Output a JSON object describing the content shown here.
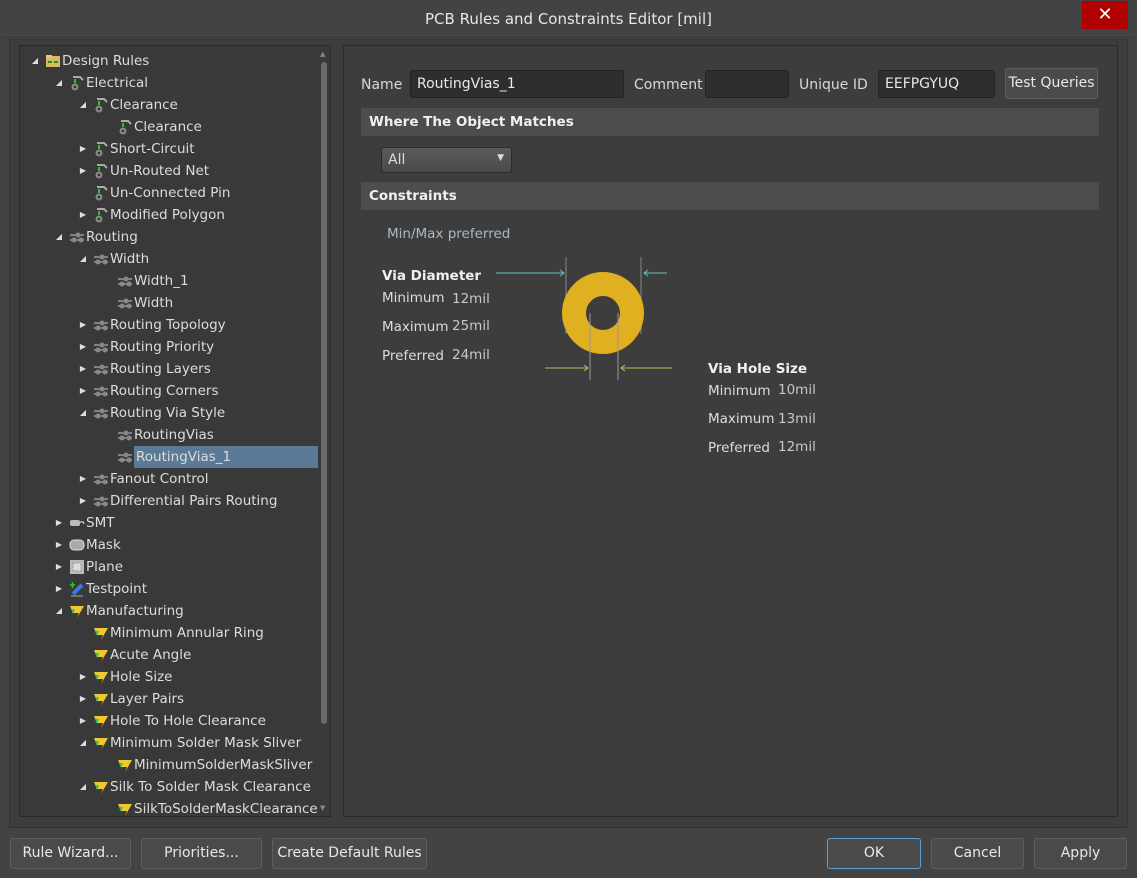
{
  "window": {
    "title": "PCB Rules and Constraints Editor [mil]",
    "close_icon": "close-icon"
  },
  "tree": [
    {
      "level": 0,
      "exp": "open",
      "icon": "folder",
      "label": "Design Rules"
    },
    {
      "level": 1,
      "exp": "open",
      "icon": "electrical",
      "label": "Electrical"
    },
    {
      "level": 2,
      "exp": "open",
      "icon": "electrical",
      "label": "Clearance"
    },
    {
      "level": 3,
      "exp": "none",
      "icon": "electrical",
      "label": "Clearance"
    },
    {
      "level": 2,
      "exp": "closed",
      "icon": "electrical",
      "label": "Short-Circuit"
    },
    {
      "level": 2,
      "exp": "closed",
      "icon": "electrical",
      "label": "Un-Routed Net"
    },
    {
      "level": 2,
      "exp": "none",
      "icon": "electrical",
      "label": "Un-Connected Pin"
    },
    {
      "level": 2,
      "exp": "closed",
      "icon": "electrical",
      "label": "Modified Polygon"
    },
    {
      "level": 1,
      "exp": "open",
      "icon": "routing",
      "label": "Routing"
    },
    {
      "level": 2,
      "exp": "open",
      "icon": "routing",
      "label": "Width"
    },
    {
      "level": 3,
      "exp": "none",
      "icon": "routing",
      "label": "Width_1"
    },
    {
      "level": 3,
      "exp": "none",
      "icon": "routing",
      "label": "Width"
    },
    {
      "level": 2,
      "exp": "closed",
      "icon": "routing",
      "label": "Routing Topology"
    },
    {
      "level": 2,
      "exp": "closed",
      "icon": "routing",
      "label": "Routing Priority"
    },
    {
      "level": 2,
      "exp": "closed",
      "icon": "routing",
      "label": "Routing Layers"
    },
    {
      "level": 2,
      "exp": "closed",
      "icon": "routing",
      "label": "Routing Corners"
    },
    {
      "level": 2,
      "exp": "open",
      "icon": "routing",
      "label": "Routing Via Style"
    },
    {
      "level": 3,
      "exp": "none",
      "icon": "routing",
      "label": "RoutingVias"
    },
    {
      "level": 3,
      "exp": "none",
      "icon": "routing",
      "label": "RoutingVias_1",
      "selected": true
    },
    {
      "level": 2,
      "exp": "closed",
      "icon": "routing",
      "label": "Fanout Control"
    },
    {
      "level": 2,
      "exp": "closed",
      "icon": "routing",
      "label": "Differential Pairs Routing"
    },
    {
      "level": 1,
      "exp": "closed",
      "icon": "smt",
      "label": "SMT"
    },
    {
      "level": 1,
      "exp": "closed",
      "icon": "mask",
      "label": "Mask"
    },
    {
      "level": 1,
      "exp": "closed",
      "icon": "plane",
      "label": "Plane"
    },
    {
      "level": 1,
      "exp": "closed",
      "icon": "testpoint",
      "label": "Testpoint"
    },
    {
      "level": 1,
      "exp": "open",
      "icon": "manufacturing",
      "label": "Manufacturing"
    },
    {
      "level": 2,
      "exp": "none",
      "icon": "manufacturing",
      "label": "Minimum Annular Ring"
    },
    {
      "level": 2,
      "exp": "none",
      "icon": "manufacturing",
      "label": "Acute Angle"
    },
    {
      "level": 2,
      "exp": "closed",
      "icon": "manufacturing",
      "label": "Hole Size"
    },
    {
      "level": 2,
      "exp": "closed",
      "icon": "manufacturing",
      "label": "Layer Pairs"
    },
    {
      "level": 2,
      "exp": "closed",
      "icon": "manufacturing",
      "label": "Hole To Hole Clearance"
    },
    {
      "level": 2,
      "exp": "open",
      "icon": "manufacturing",
      "label": "Minimum Solder Mask Sliver"
    },
    {
      "level": 3,
      "exp": "none",
      "icon": "manufacturing",
      "label": "MinimumSolderMaskSliver"
    },
    {
      "level": 2,
      "exp": "open",
      "icon": "manufacturing",
      "label": "Silk To Solder Mask Clearance"
    },
    {
      "level": 3,
      "exp": "none",
      "icon": "manufacturing",
      "label": "SilkToSolderMaskClearance"
    }
  ],
  "rule": {
    "name_label": "Name",
    "name": "RoutingVias_1",
    "comment_label": "Comment",
    "comment": "",
    "uid_label": "Unique ID",
    "uid": "EEFPGYUQ",
    "test_queries": "Test Queries"
  },
  "where": {
    "title": "Where The Object Matches",
    "selected": "All"
  },
  "constraints": {
    "title": "Constraints",
    "mode": "Min/Max preferred",
    "via_diameter": {
      "title": "Via Diameter",
      "min_label": "Minimum",
      "min": "12mil",
      "max_label": "Maximum",
      "max": "25mil",
      "pref_label": "Preferred",
      "pref": "24mil"
    },
    "via_hole": {
      "title": "Via Hole Size",
      "min_label": "Minimum",
      "min": "10mil",
      "max_label": "Maximum",
      "max": "13mil",
      "pref_label": "Preferred",
      "pref": "12mil"
    },
    "colors": {
      "via": "#e0b020",
      "diameter_arrow": "#5ec8c0",
      "hole_arrow": "#a8c860"
    }
  },
  "footer": {
    "rule_wizard": "Rule Wizard...",
    "priorities": "Priorities...",
    "create_default": "Create Default Rules",
    "ok": "OK",
    "cancel": "Cancel",
    "apply": "Apply"
  }
}
